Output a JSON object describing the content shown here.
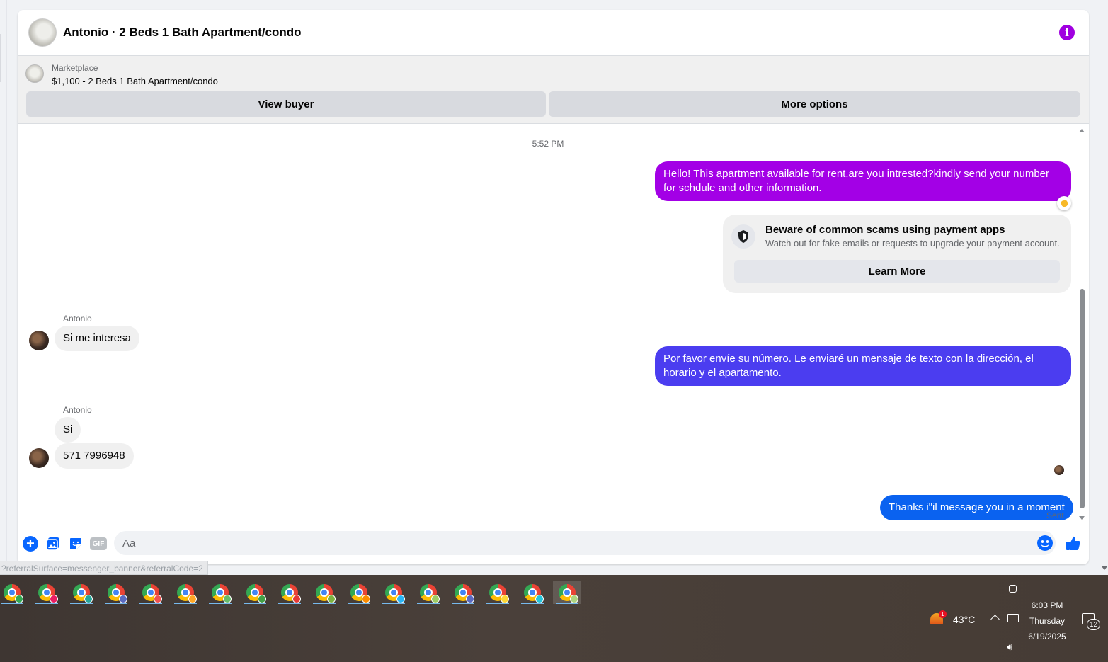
{
  "header": {
    "title": "Antonio · 2 Beds 1 Bath Apartment/condo"
  },
  "listing": {
    "label": "Marketplace",
    "price_title": "$1,100 - 2 Beds 1 Bath Apartment/condo",
    "view_buyer": "View buyer",
    "more_options": "More options"
  },
  "chat": {
    "timestamp": "5:52 PM",
    "msg_out_1": "Hello! This apartment available for rent.are you intrested?kindly send your number for schdule and other information.",
    "scam_card": {
      "title": "Beware of common scams using payment apps",
      "desc": "Watch out for fake emails or requests to upgrade your payment account.",
      "button": "Learn More"
    },
    "sender_name_1": "Antonio",
    "msg_in_1": "Si me interesa",
    "msg_out_2": "Por favor envíe su número. Le enviaré un mensaje de texto con la dirección, el horario y el apartamento.",
    "sender_name_2": "Antonio",
    "msg_in_2": "Si",
    "msg_in_3": "571 7996948",
    "msg_out_3": "Thanks i\"il message you in a moment",
    "sent_label": "Sent"
  },
  "composer": {
    "placeholder": "Aa",
    "gif_label": "GIF"
  },
  "status_url": "?referralSurface=messenger_banner&referralCode=2",
  "taskbar": {
    "apps": [
      {
        "name": "chrome-profile-1",
        "profile_color": "#34a853"
      },
      {
        "name": "chrome-profile-2",
        "profile_color": "#e91e63"
      },
      {
        "name": "chrome-profile-3",
        "profile_color": "#26a69a"
      },
      {
        "name": "chrome-profile-4",
        "profile_color": "#5c6bc0"
      },
      {
        "name": "chrome-profile-5",
        "profile_color": "#ef5350"
      },
      {
        "name": "chrome-profile-6",
        "profile_color": "#ffa726"
      },
      {
        "name": "chrome-profile-7",
        "profile_color": "#66bb6a"
      },
      {
        "name": "chrome-profile-8",
        "profile_color": "#43a047"
      },
      {
        "name": "chrome-profile-9",
        "profile_color": "#e53935"
      },
      {
        "name": "chrome-profile-10",
        "profile_color": "#7cb342"
      },
      {
        "name": "chrome-profile-11",
        "profile_color": "#fb8c00"
      },
      {
        "name": "chrome-profile-12",
        "profile_color": "#29b6f6"
      },
      {
        "name": "chrome-profile-13",
        "profile_color": "#9ccc65"
      },
      {
        "name": "chrome-profile-14",
        "profile_color": "#5c6bc0"
      },
      {
        "name": "chrome-profile-15",
        "profile_color": "#fdd835"
      },
      {
        "name": "chrome-profile-16",
        "profile_color": "#26c6da"
      },
      {
        "name": "chrome-profile-17",
        "profile_color": "#aed581"
      }
    ],
    "active_index": 16,
    "weather_temp": "43°C",
    "weather_badge": "1",
    "time": "6:03 PM",
    "day": "Thursday",
    "date": "6/19/2025",
    "notification_count": "12"
  },
  "colors": {
    "accent_purple": "#a300e6",
    "accent_indigo": "#4b3df0",
    "accent_blue": "#0a62f0",
    "messenger_blue": "#0866ff"
  }
}
